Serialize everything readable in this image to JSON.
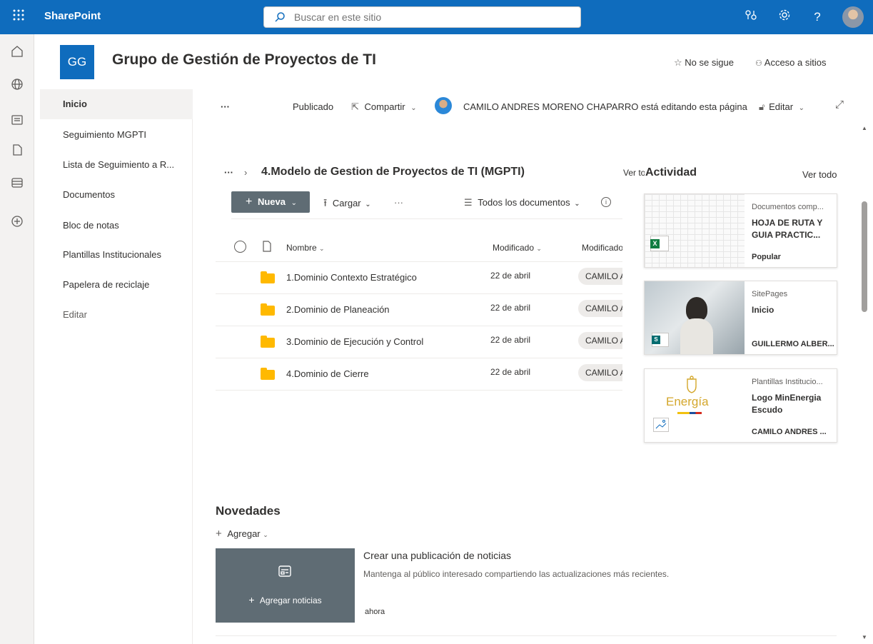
{
  "topbar": {
    "brand": "SharePoint",
    "search_placeholder": "Buscar en este sitio"
  },
  "site": {
    "logo_initials": "GG",
    "title": "Grupo de Gestión de Proyectos de TI",
    "follow": "No se sigue",
    "sites_access": "Acceso a sitios"
  },
  "nav": {
    "items": [
      {
        "label": "Inicio"
      },
      {
        "label": "Seguimiento MGPTI"
      },
      {
        "label": "Lista de Seguimiento a R..."
      },
      {
        "label": "Documentos"
      },
      {
        "label": "Bloc de notas"
      },
      {
        "label": "Plantillas Institucionales"
      },
      {
        "label": "Papelera de reciclaje"
      },
      {
        "label": "Editar"
      }
    ]
  },
  "command": {
    "more": "···",
    "published": "Publicado",
    "share": "Compartir",
    "editing_notice": "CAMILO ANDRES MORENO CHAPARRO está editando esta página",
    "edit": "Editar"
  },
  "library": {
    "more": "···",
    "title": "4.Modelo de Gestion de Proyectos de TI (MGPTI)",
    "see_all": "Ver todo",
    "new_label": "Nueva",
    "upload_label": "Cargar",
    "toolbar_more": "···",
    "view_label": "Todos los documentos",
    "columns": {
      "name": "Nombre",
      "modified": "Modificado",
      "modified_by": "Modificado"
    },
    "rows": [
      {
        "name": "1.Dominio Contexto Estratégico",
        "date": "22 de abril",
        "by": "CAMILO AN"
      },
      {
        "name": "2.Dominio de Planeación",
        "date": "22 de abril",
        "by": "CAMILO AN"
      },
      {
        "name": "3.Dominio de Ejecución y Control",
        "date": "22 de abril",
        "by": "CAMILO AN"
      },
      {
        "name": "4.Dominio de Cierre",
        "date": "22 de abril",
        "by": "CAMILO AN"
      }
    ]
  },
  "activity": {
    "title": "Actividad",
    "see_all": "Ver todo",
    "cards": [
      {
        "category": "Documentos comp...",
        "title": "HOJA DE RUTA Y GUIA PRACTIC...",
        "footer": "Popular"
      },
      {
        "category": "SitePages",
        "title": "Inicio",
        "footer": "GUILLERMO ALBER..."
      },
      {
        "category": "Plantillas Institucio...",
        "title": "Logo MinEnergia Escudo",
        "footer": "CAMILO ANDRES ...",
        "logo_text": "Energía"
      }
    ]
  },
  "news": {
    "title": "Novedades",
    "add": "Agregar",
    "add_news": "Agregar noticias",
    "create_title": "Crear una publicación de noticias",
    "create_desc": "Mantenga al público interesado compartiendo las actualizaciones más recientes.",
    "time": "ahora"
  },
  "colors": {
    "brand": "#0f6cbd",
    "command_gray": "#5f6c74",
    "folder": "#ffb900"
  }
}
